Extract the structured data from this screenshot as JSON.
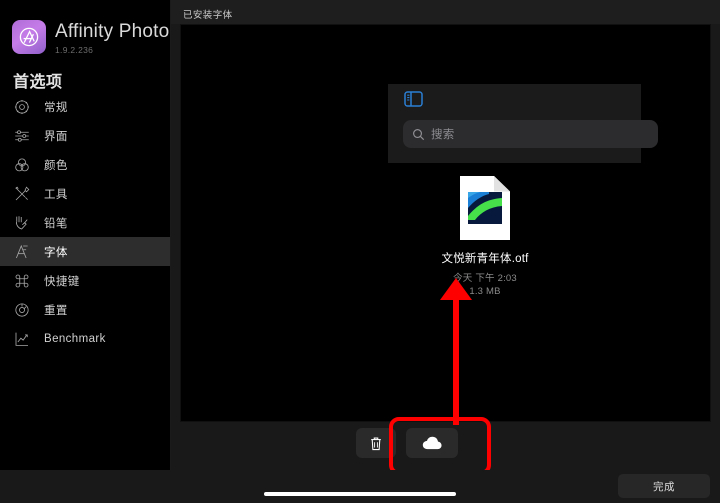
{
  "app": {
    "name": "Affinity Photo",
    "version": "1.9.2.236",
    "logo_icon": "affinity-photo-logo-icon"
  },
  "sidebar": {
    "section_title": "首选项",
    "items": [
      {
        "label": "常规",
        "icon": "gear-icon",
        "selected": false
      },
      {
        "label": "界面",
        "icon": "sliders-icon",
        "selected": false
      },
      {
        "label": "颜色",
        "icon": "color-circles-icon",
        "selected": false
      },
      {
        "label": "工具",
        "icon": "tools-icon",
        "selected": false
      },
      {
        "label": "铅笔",
        "icon": "pencil-hand-icon",
        "selected": false
      },
      {
        "label": "字体",
        "icon": "font-a-icon",
        "selected": true
      },
      {
        "label": "快捷键",
        "icon": "command-key-icon",
        "selected": false
      },
      {
        "label": "重置",
        "icon": "reset-icon",
        "selected": false
      },
      {
        "label": "Benchmark",
        "icon": "chart-line-icon",
        "selected": false
      }
    ]
  },
  "content": {
    "header_title": "已安装字体"
  },
  "picker": {
    "sidebar_toggle_icon": "sidebar-toggle-icon",
    "search": {
      "icon": "search-icon",
      "placeholder": "搜索",
      "value": ""
    },
    "file": {
      "icon": "otf-document-icon",
      "name": "文悦新青年体.otf",
      "date": "今天 下午 2:03",
      "size": "1.3 MB"
    },
    "toolbar": [
      {
        "label": "",
        "icon": "trash-icon",
        "name": "delete-button"
      },
      {
        "label": "",
        "icon": "cloud-icon",
        "name": "cloud-button"
      }
    ]
  },
  "footer": {
    "done_label": "完成"
  },
  "annotation": {
    "color": "#ff0000",
    "shape": "rounded-rectangle-with-arrow",
    "target": "cloud-button"
  },
  "colors": {
    "accent_blue": "#2b7fd4",
    "brand_purple": "#b06cd8",
    "annotation_red": "#ff0000",
    "panel_bg": "#191919",
    "selected_row": "#2d2d2d"
  }
}
